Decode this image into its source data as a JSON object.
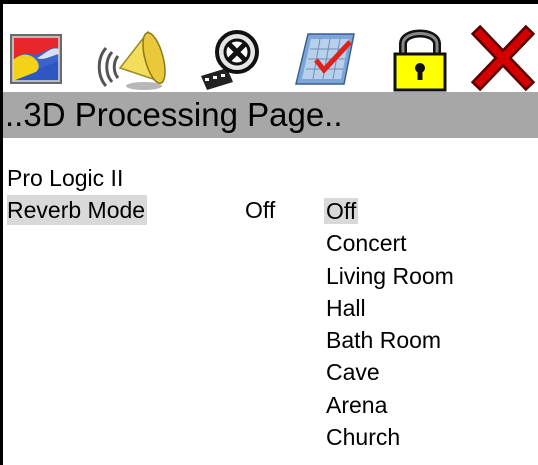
{
  "toolbar": {
    "icons": [
      {
        "name": "picture-icon"
      },
      {
        "name": "speaker-icon"
      },
      {
        "name": "film-reel-icon"
      },
      {
        "name": "checklist-icon"
      },
      {
        "name": "padlock-icon"
      },
      {
        "name": "close-x-icon"
      }
    ]
  },
  "page": {
    "title": "..3D Processing Page.."
  },
  "settings": {
    "section_label": "Pro Logic II",
    "reverb_label": "Reverb Mode",
    "reverb_value": "Off"
  },
  "reverb_options": [
    {
      "label": "Off",
      "selected": true
    },
    {
      "label": "Concert",
      "selected": false
    },
    {
      "label": "Living Room",
      "selected": false
    },
    {
      "label": "Hall",
      "selected": false
    },
    {
      "label": "Bath Room",
      "selected": false
    },
    {
      "label": "Cave",
      "selected": false
    },
    {
      "label": "Arena",
      "selected": false
    },
    {
      "label": "Church",
      "selected": false
    }
  ],
  "colors": {
    "title_bar": "#a7a7a7",
    "highlight": "#d9d9d9",
    "lock_yellow": "#ffff00",
    "close_red": "#d40000"
  }
}
